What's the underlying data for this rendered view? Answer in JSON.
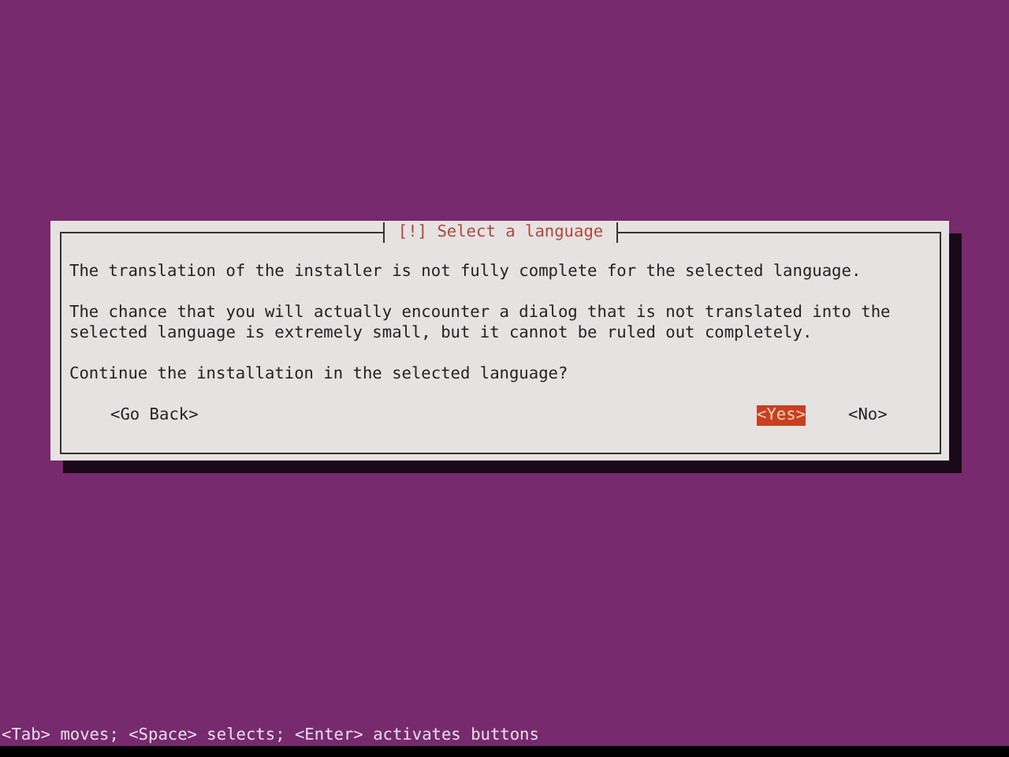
{
  "dialog": {
    "title": "[!] Select a language",
    "paragraphs": [
      "The translation of the installer is not fully complete for the selected language.",
      "The chance that you will actually encounter a dialog that is not translated into the selected language is extremely small, but it cannot be ruled out completely.",
      "Continue the installation in the selected language?"
    ],
    "buttons": [
      {
        "label": "<Go Back>",
        "selected": false
      },
      {
        "label": "<Yes>",
        "selected": true
      },
      {
        "label": "<No>",
        "selected": false
      }
    ]
  },
  "status_bar": "<Tab> moves; <Space> selects; <Enter> activates buttons"
}
